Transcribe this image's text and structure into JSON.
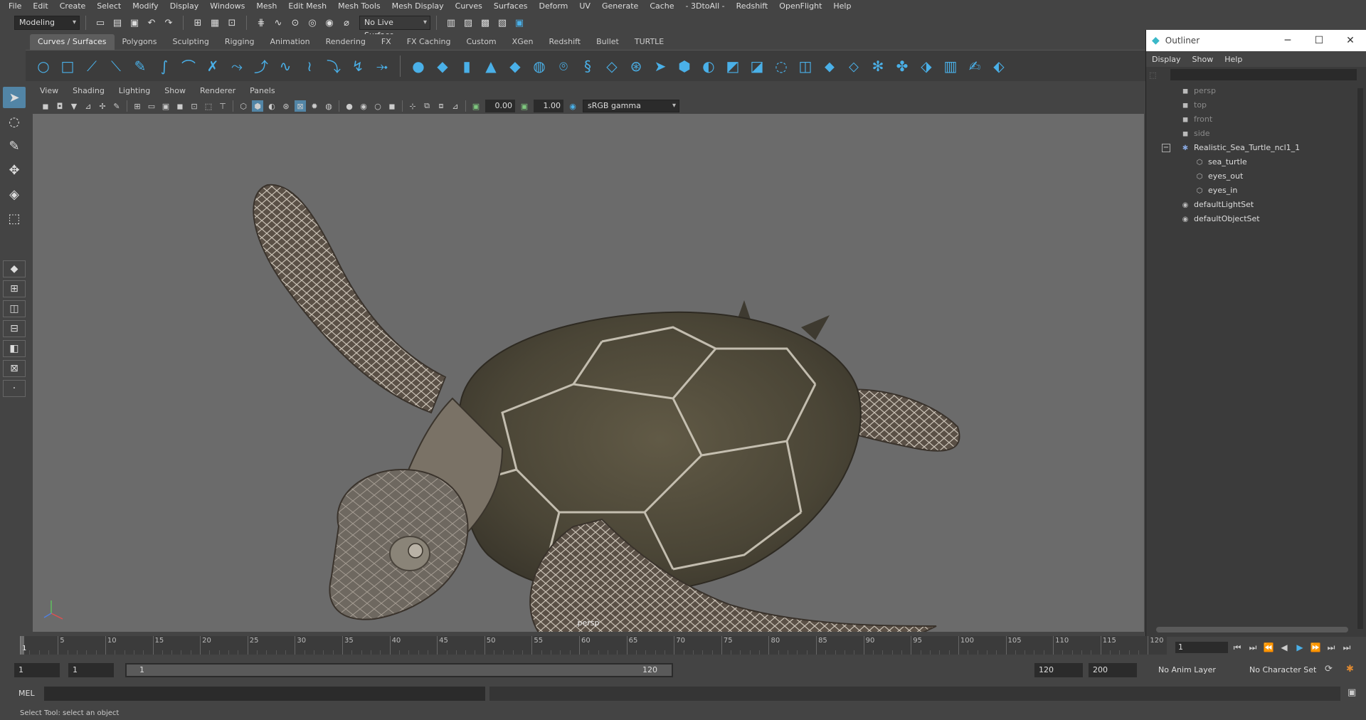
{
  "menubar": [
    "File",
    "Edit",
    "Create",
    "Select",
    "Modify",
    "Display",
    "Windows",
    "Mesh",
    "Edit Mesh",
    "Mesh Tools",
    "Mesh Display",
    "Curves",
    "Surfaces",
    "Deform",
    "UV",
    "Generate",
    "Cache",
    "- 3DtoAll -",
    "Redshift",
    "OpenFlight",
    "Help"
  ],
  "statusline": {
    "workspace": "Modeling",
    "live_surface": "No Live Surface"
  },
  "shelf_tabs": [
    "Curves / Surfaces",
    "Polygons",
    "Sculpting",
    "Rigging",
    "Animation",
    "Rendering",
    "FX",
    "FX Caching",
    "Custom",
    "XGen",
    "Redshift",
    "Bullet",
    "TURTLE"
  ],
  "shelf_active": "Curves / Surfaces",
  "viewport_menu": [
    "View",
    "Shading",
    "Lighting",
    "Show",
    "Renderer",
    "Panels"
  ],
  "viewport_toolbar": {
    "exposure": "0.00",
    "gamma": "1.00",
    "color_space": "sRGB gamma"
  },
  "viewport": {
    "camera_label": "persp",
    "bg_color": "#6b6b6b"
  },
  "outliner": {
    "title": "Outliner",
    "menu": [
      "Display",
      "Show",
      "Help"
    ],
    "items": [
      {
        "label": "persp",
        "icon": "camera-icon",
        "dim": true
      },
      {
        "label": "top",
        "icon": "camera-icon",
        "dim": true
      },
      {
        "label": "front",
        "icon": "camera-icon",
        "dim": true
      },
      {
        "label": "side",
        "icon": "camera-icon",
        "dim": true
      },
      {
        "label": "Realistic_Sea_Turtle_ncl1_1",
        "icon": "asterisk-group-icon",
        "dim": false
      },
      {
        "label": "sea_turtle",
        "icon": "mesh-icon",
        "dim": false
      },
      {
        "label": "eyes_out",
        "icon": "mesh-icon",
        "dim": false
      },
      {
        "label": "eyes_in",
        "icon": "mesh-icon",
        "dim": false
      },
      {
        "label": "defaultLightSet",
        "icon": "set-icon",
        "dim": false
      },
      {
        "label": "defaultObjectSet",
        "icon": "set-icon",
        "dim": false
      }
    ]
  },
  "timeline": {
    "ticks": [
      "1",
      "5",
      "10",
      "15",
      "20",
      "25",
      "30",
      "35",
      "40",
      "45",
      "50",
      "55",
      "60",
      "65",
      "70",
      "75",
      "80",
      "85",
      "90",
      "95",
      "100",
      "105",
      "110",
      "115",
      "120"
    ],
    "current_frame": "1"
  },
  "range": {
    "start": "1",
    "inner_start": "1",
    "slider_lo": "1",
    "slider_hi": "120",
    "end": "120",
    "max": "200",
    "anim_layer": "No Anim Layer",
    "char_set": "No Character Set"
  },
  "cmdline": {
    "label": "MEL"
  },
  "status": {
    "help_text": "Select Tool: select an object"
  },
  "colors": {
    "accent": "#4ab0e8",
    "panel": "#444444",
    "field": "#2b2b2b"
  }
}
